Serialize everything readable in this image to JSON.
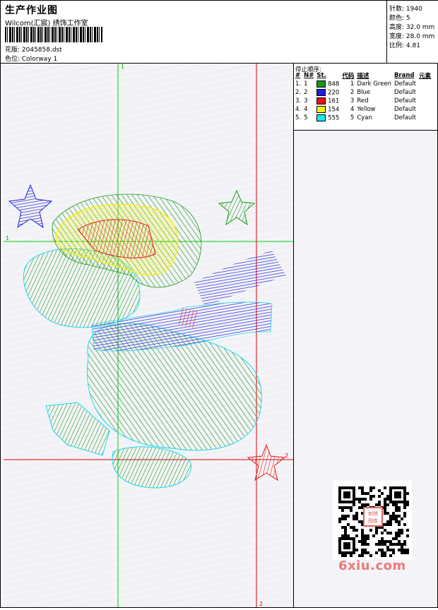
{
  "header": {
    "title": "生产作业图",
    "brand": "Wilcom(汇宸) 绣饰工作室",
    "pattern_label": "花版: 2045858.dst",
    "colorway_label": "色位: Colorway 1"
  },
  "stats": {
    "stitches": "针数: 1940",
    "colors": "颜色: 5",
    "height": "高度: 32.0 mm",
    "width": "宽度: 28.0 mm",
    "scale": "比例: 4.81"
  },
  "stop_sequence": {
    "heading": "停止顺序:",
    "columns": [
      "#",
      "N#",
      "St.",
      "代码",
      "描述",
      "Brand",
      "元素"
    ],
    "rows": [
      {
        "idx": "1.",
        "n": "1",
        "st": "848",
        "code": "1",
        "desc": "Dark Green",
        "brand": "Default",
        "color": "#14961e"
      },
      {
        "idx": "2.",
        "n": "2",
        "st": "220",
        "code": "2",
        "desc": "Blue",
        "brand": "Default",
        "color": "#1e1ee6"
      },
      {
        "idx": "3.",
        "n": "3",
        "st": "161",
        "code": "3",
        "desc": "Red",
        "brand": "Default",
        "color": "#e61414"
      },
      {
        "idx": "4.",
        "n": "4",
        "st": "154",
        "code": "4",
        "desc": "Yellow",
        "brand": "Default",
        "color": "#f0f01e"
      },
      {
        "idx": "5.",
        "n": "5",
        "st": "555",
        "code": "5",
        "desc": "Cyan",
        "brand": "Default",
        "color": "#1ee6f0"
      }
    ]
  },
  "guides": {
    "green_v": "1",
    "green_h": "1",
    "red_v": "2",
    "red_h": "2"
  },
  "watermark": "6xiu.com",
  "qr_stamp": "刺绣图库",
  "colors": {
    "green": "#1a9a1a",
    "blue": "#2020dd",
    "red": "#e02020",
    "yellow": "#f5f020",
    "cyan": "#20d8f0"
  }
}
